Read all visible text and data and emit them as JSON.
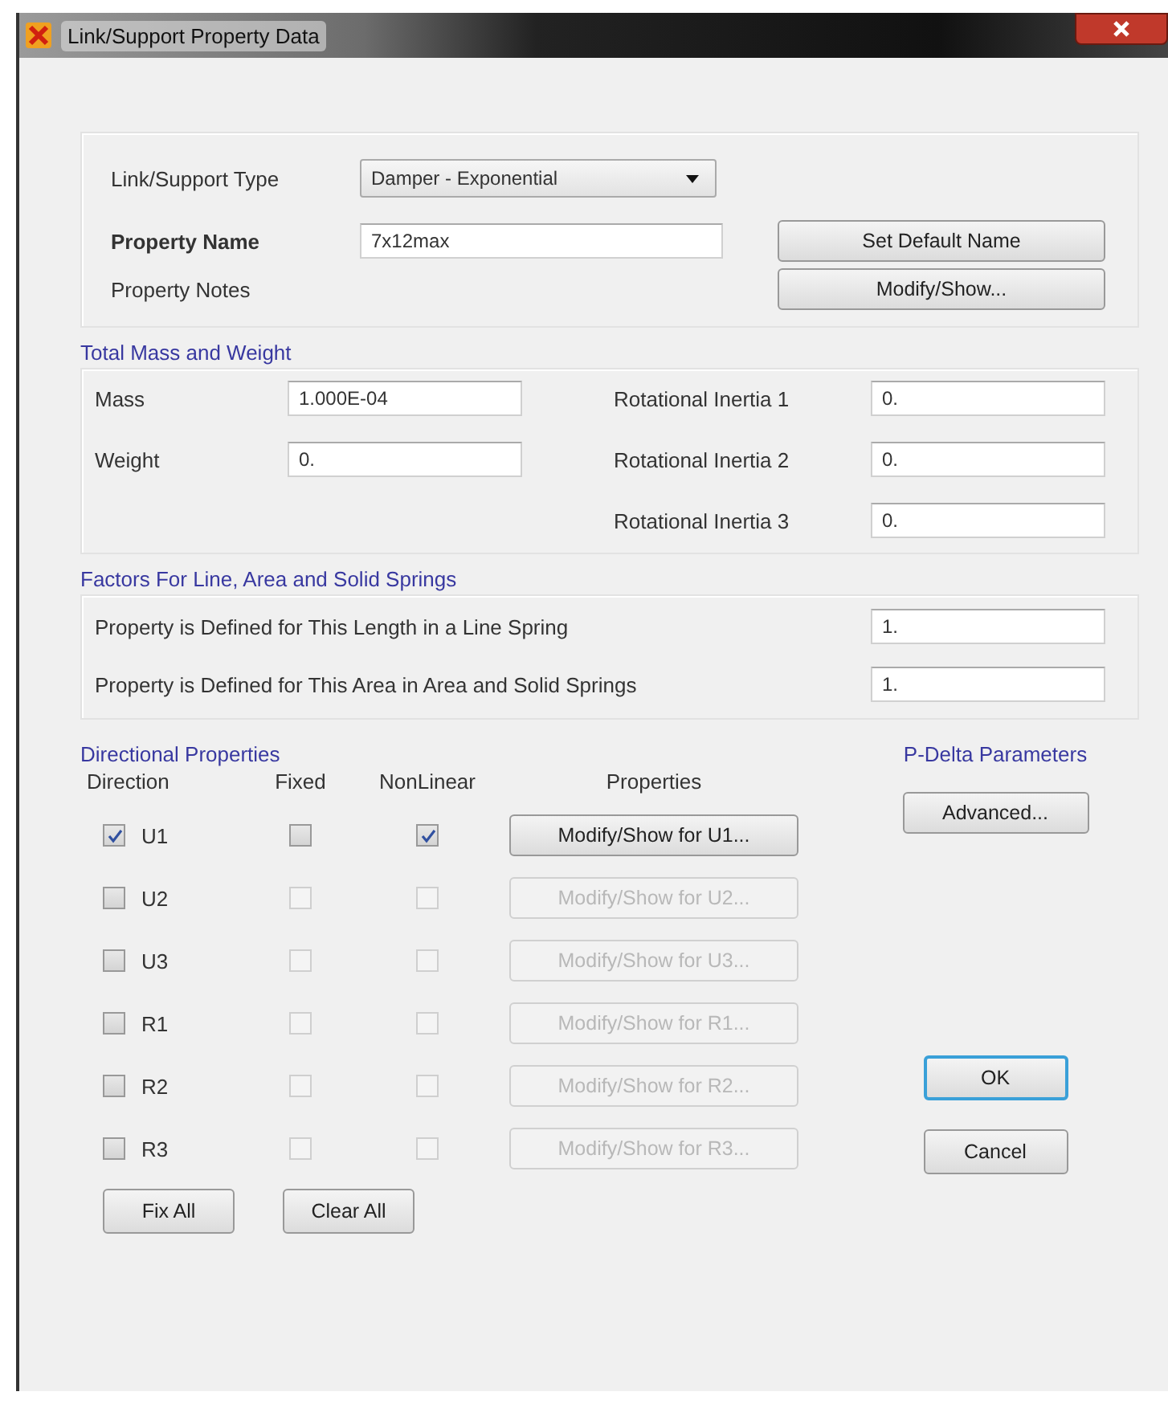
{
  "window": {
    "title": "Link/Support Property Data"
  },
  "general": {
    "type_label": "Link/Support Type",
    "type_value": "Damper - Exponential",
    "name_label": "Property Name",
    "name_value": "7x12max",
    "notes_label": "Property Notes",
    "default_name_button": "Set Default Name",
    "notes_button": "Modify/Show..."
  },
  "mass_weight": {
    "title": "Total Mass and Weight",
    "left": [
      {
        "label": "Mass",
        "value": "1.000E-04"
      },
      {
        "label": "Weight",
        "value": "0."
      }
    ],
    "right": [
      {
        "label": "Rotational Inertia 1",
        "value": "0."
      },
      {
        "label": "Rotational Inertia 2",
        "value": "0."
      },
      {
        "label": "Rotational Inertia 3",
        "value": "0."
      }
    ]
  },
  "factors": {
    "title": "Factors For Line, Area and Solid Springs",
    "rows": [
      {
        "label": "Property is Defined for This Length in a Line Spring",
        "value": "1."
      },
      {
        "label": "Property is Defined for This Area in Area and Solid Springs",
        "value": "1."
      }
    ]
  },
  "directional": {
    "title": "Directional Properties",
    "columns": [
      "Direction",
      "Fixed",
      "NonLinear",
      "Properties"
    ],
    "rows": [
      {
        "direction": "U1",
        "checked": true,
        "fixed": false,
        "nonlinear": true,
        "enabled": true,
        "button": "Modify/Show for U1..."
      },
      {
        "direction": "U2",
        "checked": false,
        "fixed": false,
        "nonlinear": false,
        "enabled": false,
        "button": "Modify/Show for U2..."
      },
      {
        "direction": "U3",
        "checked": false,
        "fixed": false,
        "nonlinear": false,
        "enabled": false,
        "button": "Modify/Show for U3..."
      },
      {
        "direction": "R1",
        "checked": false,
        "fixed": false,
        "nonlinear": false,
        "enabled": false,
        "button": "Modify/Show for R1..."
      },
      {
        "direction": "R2",
        "checked": false,
        "fixed": false,
        "nonlinear": false,
        "enabled": false,
        "button": "Modify/Show for R2..."
      },
      {
        "direction": "R3",
        "checked": false,
        "fixed": false,
        "nonlinear": false,
        "enabled": false,
        "button": "Modify/Show for R3..."
      }
    ],
    "buttons": [
      "Fix All",
      "Clear All"
    ]
  },
  "pdelta": {
    "title": "P-Delta Parameters",
    "button": "Advanced..."
  },
  "dialog_buttons": [
    {
      "label": "OK",
      "default": true
    },
    {
      "label": "Cancel",
      "default": false
    }
  ]
}
